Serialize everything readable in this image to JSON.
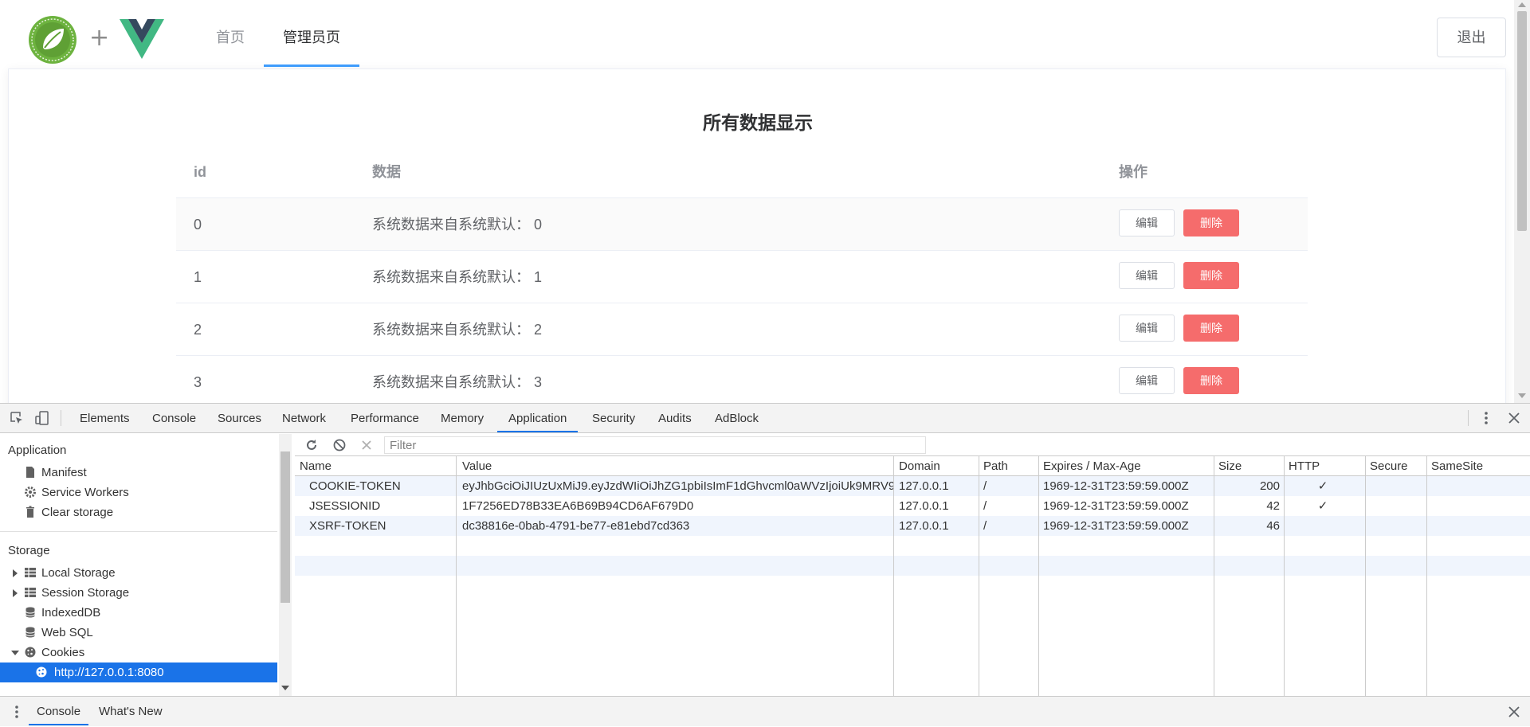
{
  "nav": {
    "home": "首页",
    "admin": "管理员页",
    "logout": "退出"
  },
  "card": {
    "title": "所有数据显示",
    "columns": [
      "id",
      "数据",
      "操作"
    ],
    "rows": [
      {
        "id": "0",
        "data": "系统数据来自系统默认： 0"
      },
      {
        "id": "1",
        "data": "系统数据来自系统默认： 1"
      },
      {
        "id": "2",
        "data": "系统数据来自系统默认： 2"
      },
      {
        "id": "3",
        "data": "系统数据来自系统默认： 3"
      }
    ],
    "edit_label": "编辑",
    "delete_label": "删除"
  },
  "devtools": {
    "tabs": [
      "Elements",
      "Console",
      "Sources",
      "Network",
      "Performance",
      "Memory",
      "Application",
      "Security",
      "Audits",
      "AdBlock"
    ],
    "active_tab": "Application",
    "sidebar": {
      "application_header": "Application",
      "manifest": "Manifest",
      "service_workers": "Service Workers",
      "clear_storage": "Clear storage",
      "storage_header": "Storage",
      "local_storage": "Local Storage",
      "session_storage": "Session Storage",
      "indexeddb": "IndexedDB",
      "web_sql": "Web SQL",
      "cookies": "Cookies",
      "cookie_origin": "http://127.0.0.1:8080"
    },
    "filter_placeholder": "Filter",
    "cookie_columns": [
      "Name",
      "Value",
      "Domain",
      "Path",
      "Expires / Max-Age",
      "Size",
      "HTTP",
      "Secure",
      "SameSite"
    ],
    "cookies": [
      {
        "name": "COOKIE-TOKEN",
        "value": "eyJhbGciOiJIUzUxMiJ9.eyJzdWIiOiJhZG1pbiIsImF1dGhvcml0aWVzIjoiUk9MRV9...",
        "domain": "127.0.0.1",
        "path": "/",
        "expires": "1969-12-31T23:59:59.000Z",
        "size": "200",
        "http": "✓",
        "secure": "",
        "samesite": ""
      },
      {
        "name": "JSESSIONID",
        "value": "1F7256ED78B33EA6B69B94CD6AF679D0",
        "domain": "127.0.0.1",
        "path": "/",
        "expires": "1969-12-31T23:59:59.000Z",
        "size": "42",
        "http": "✓",
        "secure": "",
        "samesite": ""
      },
      {
        "name": "XSRF-TOKEN",
        "value": "dc38816e-0bab-4791-be77-e81ebd7cd363",
        "domain": "127.0.0.1",
        "path": "/",
        "expires": "1969-12-31T23:59:59.000Z",
        "size": "46",
        "http": "",
        "secure": "",
        "samesite": ""
      }
    ],
    "drawer_tabs": [
      "Console",
      "What's New"
    ]
  },
  "colors": {
    "primary": "#409eff",
    "danger": "#f56c6c",
    "vue_green": "#41b883",
    "vue_dark": "#35495e",
    "spring_green": "#6db33f",
    "devtools_accent": "#1a73e8"
  }
}
